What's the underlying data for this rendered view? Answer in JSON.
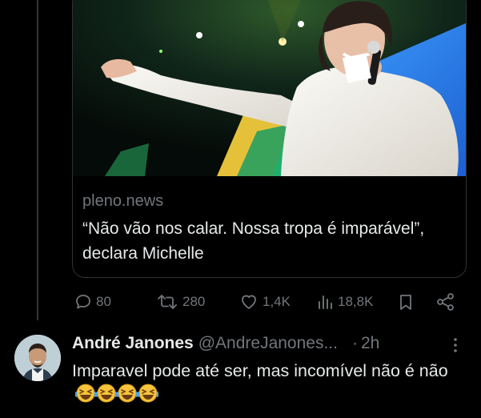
{
  "link_card": {
    "domain": "pleno.news",
    "headline": "“Não vão nos calar. Nossa tropa é imparável”, declara Michelle"
  },
  "actions": {
    "replies": "80",
    "reposts": "280",
    "likes": "1,4K",
    "views": "18,8K",
    "icons": [
      "reply-icon",
      "repost-icon",
      "like-icon",
      "views-icon",
      "bookmark-icon",
      "share-icon"
    ]
  },
  "reply": {
    "name": "André Janones",
    "handle": "@AndreJanones...",
    "dot": "·",
    "time": "2h",
    "text": "Imparavel pode até ser, mas incomível não é não",
    "emoji": "🤣🤣🤣🤣"
  },
  "colors": {
    "background": "#000000",
    "text": "#e7e9ea",
    "muted": "#71767b",
    "border": "#2f3336"
  }
}
